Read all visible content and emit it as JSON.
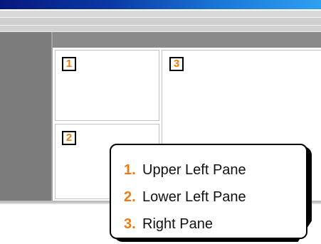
{
  "panes": {
    "upper_left": {
      "badge": "1"
    },
    "lower_left": {
      "badge": "2"
    },
    "right": {
      "badge": "3"
    }
  },
  "legend": {
    "items": [
      {
        "number": "1.",
        "label": "Upper Left Pane"
      },
      {
        "number": "2.",
        "label": "Lower Left Pane"
      },
      {
        "number": "3.",
        "label": "Right Pane"
      }
    ]
  },
  "colors": {
    "titlebar_start": "#06187f",
    "titlebar_end": "#2ea0f2",
    "badge_number": "#f07a12",
    "nav_column": "#7c7c7c",
    "header_band": "#8a8a8a"
  }
}
